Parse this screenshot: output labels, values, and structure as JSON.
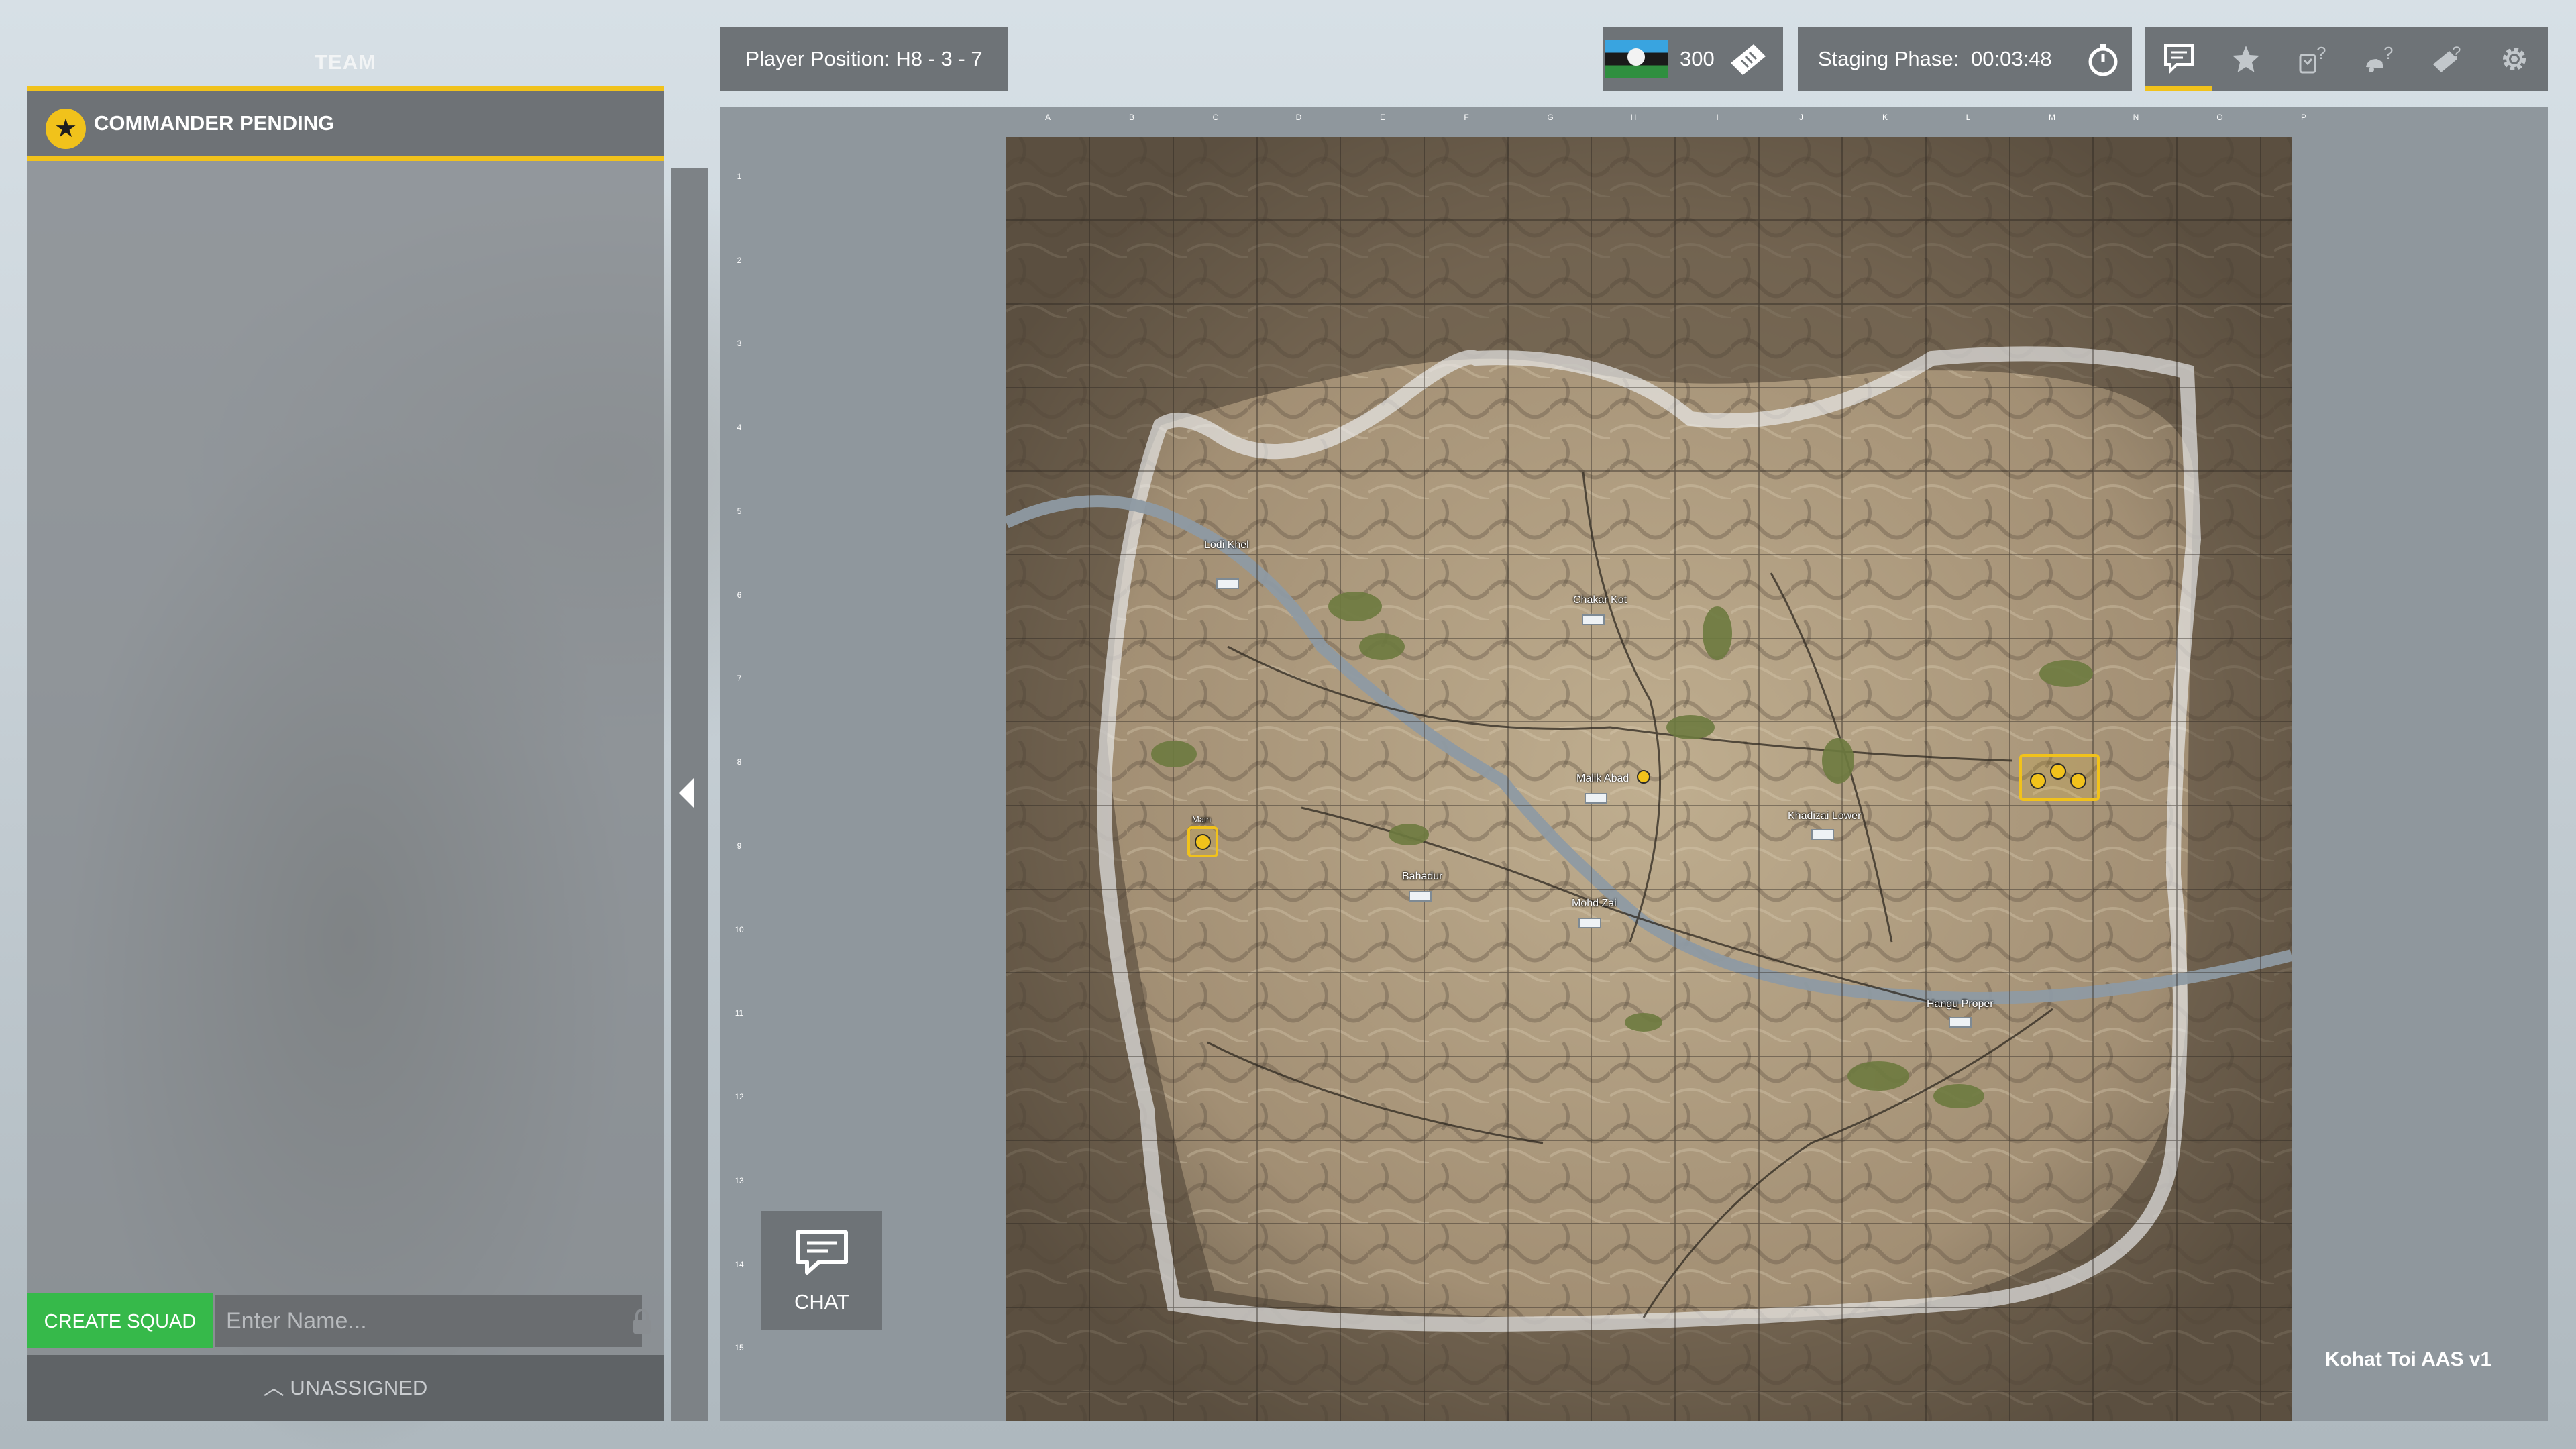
{
  "team_panel": {
    "title": "TEAM",
    "commander_label": "COMMANDER PENDING",
    "commander_icon": "star-icon",
    "create_squad_label": "CREATE SQUAD",
    "squad_name_placeholder": "Enter Name...",
    "squad_name_value": "",
    "unassigned_label": "UNASSIGNED",
    "accent_color": "#f1c21b",
    "create_color": "#36b94a"
  },
  "top_bar": {
    "player_position": "Player Position: H8 - 3 - 7",
    "tickets": "300",
    "staging_label": "Staging Phase:",
    "staging_time": "00:03:48",
    "menu_icons": [
      "chat-icon",
      "star-icon",
      "squad-leader-help-icon",
      "vehicle-help-icon",
      "deploy-help-icon",
      "gear-icon"
    ]
  },
  "map": {
    "grid_columns": [
      "A",
      "B",
      "C",
      "D",
      "E",
      "F",
      "G",
      "H",
      "I",
      "J",
      "K",
      "L",
      "M",
      "N",
      "O",
      "P"
    ],
    "grid_rows": [
      "1",
      "2",
      "3",
      "4",
      "5",
      "6",
      "7",
      "8",
      "9",
      "10",
      "11",
      "12",
      "13",
      "14",
      "15"
    ],
    "locations": [
      "Lodi Khel",
      "Chakar Kot",
      "Malik Abad",
      "Khadizai Lower",
      "Bahadur",
      "Mohd Zai",
      "Hangu Proper"
    ],
    "objective_labels": [
      "Main"
    ],
    "map_name": "Kohat Toi AAS v1"
  },
  "chat": {
    "label": "CHAT"
  }
}
